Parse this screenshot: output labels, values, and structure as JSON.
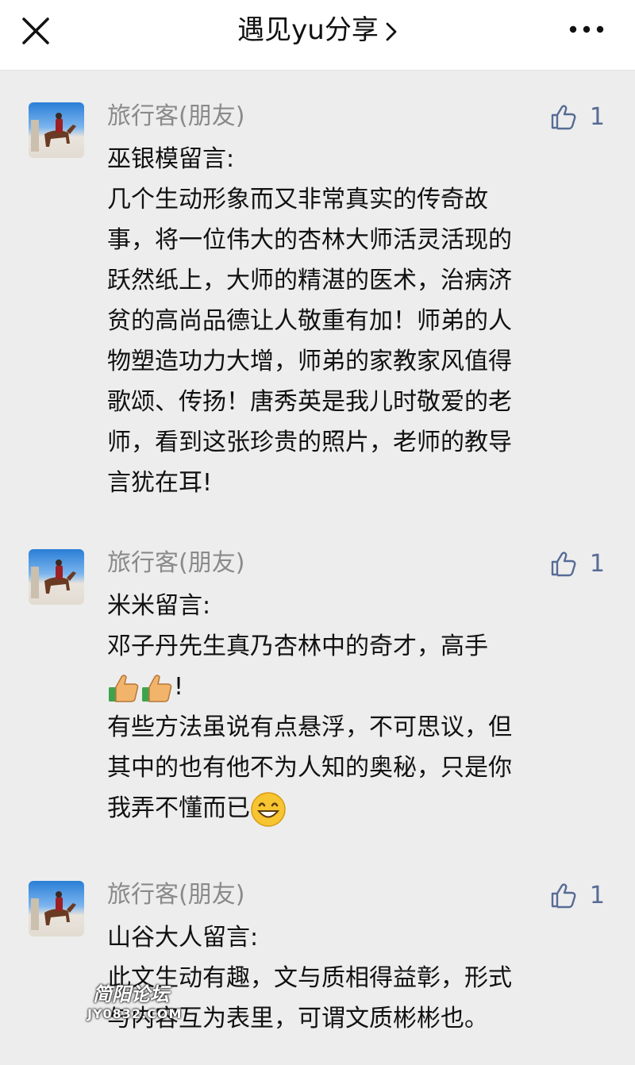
{
  "header": {
    "title": "遇见yu分享",
    "close_icon": "close-icon",
    "more_icon": "more-dots-icon",
    "chevron_icon": "chevron-right-icon"
  },
  "comments": [
    {
      "nickname": "旅行客(朋友)",
      "likes": "1",
      "lines": [
        "巫银模留言:",
        "几个生动形象而又非常真实的传奇故",
        "事，将一位伟大的杏林大师活灵活现的",
        "跃然纸上，大师的精湛的医术，治病济",
        "贫的高尚品德让人敬重有加！师弟的人",
        "物塑造功力大增，师弟的家教家风值得",
        "歌颂、传扬！唐秀英是我儿时敬爱的老",
        "师，看到这张珍贵的照片，老师的教导",
        "言犹在耳!"
      ]
    },
    {
      "nickname": "旅行客(朋友)",
      "likes": "1",
      "lines": [
        "米米留言:",
        "邓子丹先生真乃杏林中的奇才，高手",
        "!",
        "有些方法虽说有点悬浮，不可思议，但",
        "其中的也有他不为人知的奥秘，只是你",
        "我弄不懂而已"
      ]
    },
    {
      "nickname": "旅行客(朋友)",
      "likes": "1",
      "lines": [
        "山谷大人留言:",
        "此文生动有趣，文与质相得益彰，形式",
        "与内容互为表里，可谓文质彬彬也。"
      ]
    }
  ],
  "watermark": {
    "line1": "简阳论坛",
    "line2": "JY0832.COM"
  },
  "colors": {
    "background": "#ededed",
    "header_bg": "#ffffff",
    "nickname": "#8a8a8a",
    "like_blue": "#576b95"
  }
}
